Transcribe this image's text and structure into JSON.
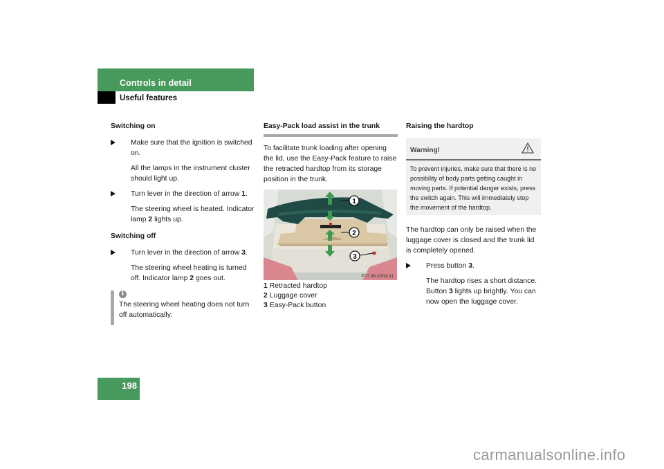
{
  "header": {
    "section": "Controls in detail",
    "subsection": "Useful features"
  },
  "column1": {
    "switching_on": {
      "heading": "Switching on",
      "step1": "Make sure that the ignition is switched on.",
      "step1_result": "All the lamps in the instrument cluster should light up.",
      "step2_pre": "Turn lever in the direction of arrow ",
      "step2_num": "1",
      "step2_post": ".",
      "step2_result_pre": "The steering wheel is heated. Indicator lamp ",
      "step2_result_num": "2",
      "step2_result_post": " lights up."
    },
    "switching_off": {
      "heading": "Switching off",
      "step1_pre": "Turn lever in the direction of arrow ",
      "step1_num": "3",
      "step1_post": ".",
      "step1_result_pre": "The steering wheel heating is turned off. Indicator lamp ",
      "step1_result_num": "2",
      "step1_result_post": " goes out."
    },
    "info_note": {
      "icon": "info-icon",
      "text": "The steering wheel heating does not turn off automatically."
    }
  },
  "column2": {
    "heading": "Easy-Pack load assist in the trunk",
    "intro": "To facilitate trunk loading after opening the lid, use the Easy-Pack feature to raise the retracted hardtop from its storage position in the trunk.",
    "figure": {
      "code": "P77.38-2003-31",
      "callouts": [
        "1",
        "2",
        "3"
      ]
    },
    "legend": [
      {
        "num": "1",
        "label": "Retracted hardtop"
      },
      {
        "num": "2",
        "label": "Luggage cover"
      },
      {
        "num": "3",
        "label": "Easy-Pack button"
      }
    ]
  },
  "column3": {
    "heading": "Raising the hardtop",
    "warning": {
      "title": "Warning!",
      "icon": "warning-triangle-icon",
      "text": "To prevent injuries, make sure that there is no possibility of body parts getting caught in moving parts. If potential danger exists, press the switch again. This will immediately stop the movement of the hardtop."
    },
    "body": "The hardtop can only be raised when the luggage cover is closed and the trunk lid is completely opened.",
    "step1_pre": "Press button ",
    "step1_num": "3",
    "step1_post": ".",
    "step1_result_pre1": "The hardtop rises a short distance. Button ",
    "step1_result_num": "3",
    "step1_result_post": " lights up brightly. You can now open the luggage cover."
  },
  "page_number": "198",
  "watermark": "carmanualsonline.info",
  "colors": {
    "brand_green": "#47995c",
    "arrow_green": "#3f9a4f",
    "info_bar": "#a8a8a8",
    "warning_bg": "#f0f0f0"
  }
}
